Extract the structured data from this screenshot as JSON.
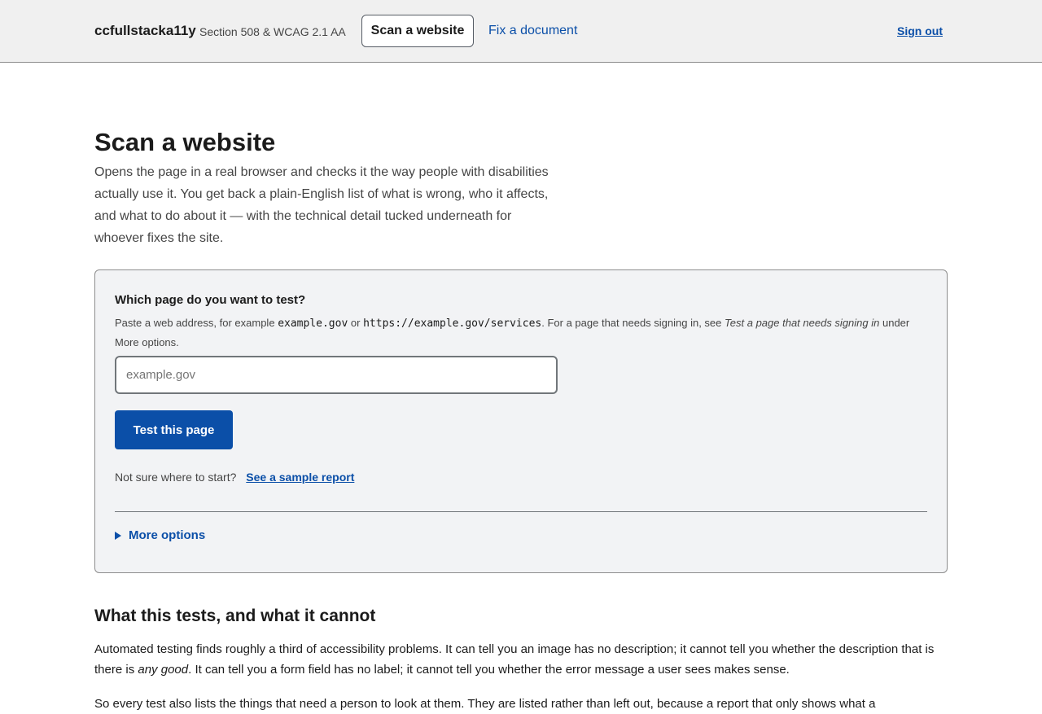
{
  "header": {
    "brand": "ccfullstacka11y",
    "subtitle": "Section 508 & WCAG 2.1 AA",
    "nav": {
      "current": "Scan a website",
      "fix_document": "Fix a document"
    },
    "sign_out": "Sign out"
  },
  "page": {
    "title": "Scan a website",
    "intro": "Opens the page in a real browser and checks it the way people with disabilities actually use it. You get back a plain-English list of what is wrong, who it affects, and what to do about it — with the technical detail tucked underneath for whoever fixes the site."
  },
  "form": {
    "label": "Which page do you want to test?",
    "hint": {
      "prefix": "Paste a web address, for example",
      "example1": "example.gov",
      "or": "or",
      "example2": "https://example.gov/services",
      "middle": ". For a page that needs signing in, see",
      "link_text": "Test a page that needs signing in",
      "suffix": "under More options."
    },
    "input_placeholder": "example.gov",
    "input_value": "",
    "submit": "Test this page",
    "sample_prompt": "Not sure where to start?",
    "sample_link": "See a sample report",
    "more_options": "More options"
  },
  "section": {
    "title": "What this tests, and what it cannot",
    "p1_a": "Automated testing finds roughly a third of accessibility problems. It can tell you an image has no description; it cannot tell you whether the description that is there is",
    "p1_em": "any good",
    "p1_b": ". It can tell you a form field has no label; it cannot tell you whether the error message a user sees makes sense.",
    "p2": "So every test also lists the things that need a person to look at them. They are listed rather than left out, because a report that only shows what a"
  },
  "colors": {
    "primary": "#0b4fa8",
    "header_bg": "#f0f0f0",
    "card_bg": "#f2f3f5"
  }
}
